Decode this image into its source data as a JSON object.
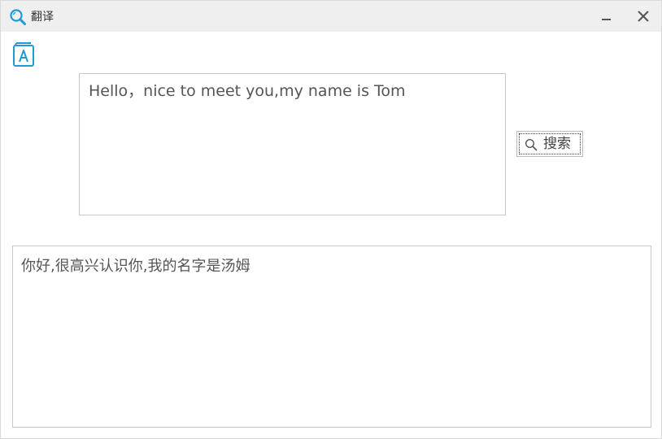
{
  "window": {
    "title": "翻译",
    "title_icon": "search-icon",
    "controls": [
      "minimize-icon",
      "close-icon"
    ]
  },
  "toolbar": {
    "dictionary_icon": "translate-book-icon"
  },
  "source": {
    "text": "Hello，nice to meet you,my name is Tom"
  },
  "search_button": {
    "label": "搜索",
    "icon": "search-icon"
  },
  "result": {
    "text": "你好,很高兴认识你,我的名字是汤姆"
  },
  "colors": {
    "accent": "#1e9bd7",
    "titlebar": "#efefef",
    "border": "#c8c8c8",
    "text": "#555555"
  }
}
